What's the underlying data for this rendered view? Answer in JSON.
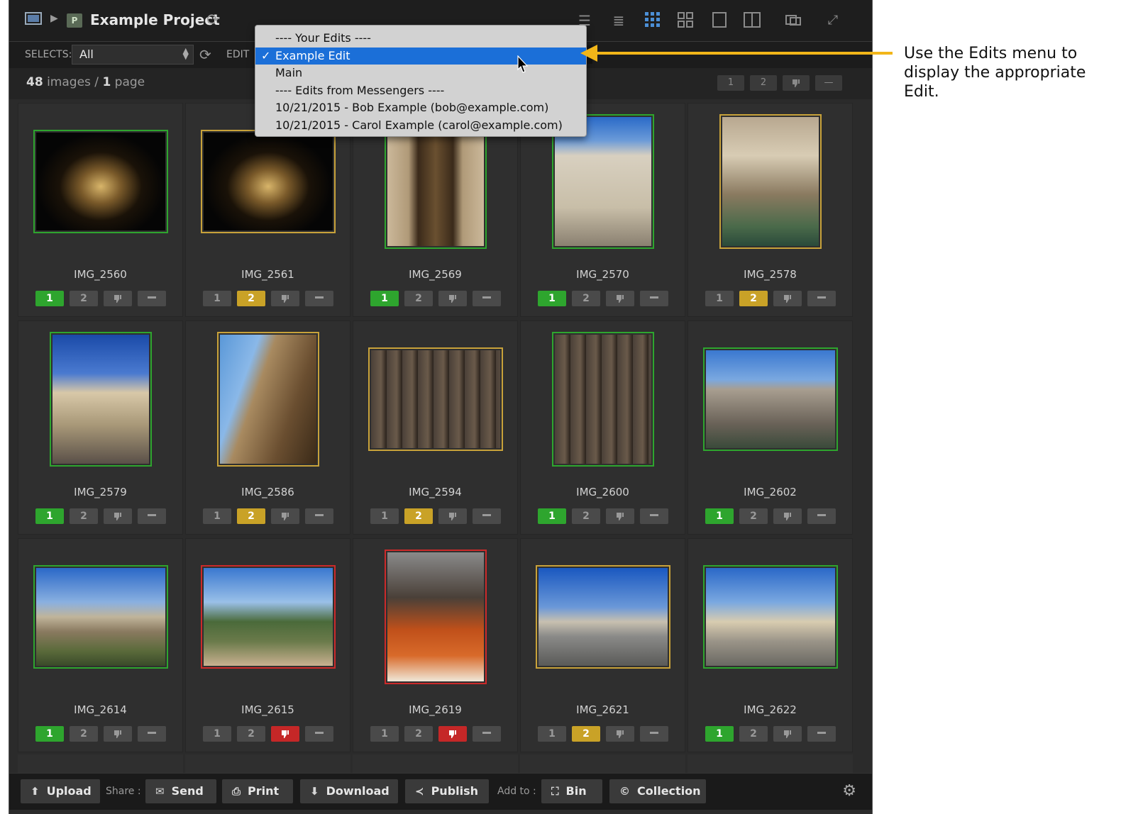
{
  "app": {
    "project_badge": "P",
    "project_title": "Example Project"
  },
  "toolbar": {
    "selects_label": "SELECTS:",
    "selects_value": "All",
    "edits_label": "EDIT"
  },
  "info": {
    "count": "48",
    "count_label": " images",
    "sep": " / ",
    "pages": "1",
    "pages_label": " page"
  },
  "page_buttons": [
    "1",
    "2"
  ],
  "dropdown": {
    "items": [
      {
        "label": "---- Your Edits ----",
        "selected": false
      },
      {
        "label": "Example Edit",
        "selected": true
      },
      {
        "label": "Main",
        "selected": false
      },
      {
        "label": "---- Edits from Messengers ----",
        "selected": false
      },
      {
        "label": "10/21/2015 - Bob Example (bob@example.com)",
        "selected": false
      },
      {
        "label": "10/21/2015 - Carol Example (carol@example.com)",
        "selected": false
      }
    ],
    "check": "✓"
  },
  "rating_labels": {
    "one": "1",
    "two": "2"
  },
  "images": [
    {
      "name": "IMG_2560",
      "rating": "1",
      "border": "green",
      "scene": "night"
    },
    {
      "name": "IMG_2561",
      "rating": "2",
      "border": "yellow",
      "scene": "night"
    },
    {
      "name": "IMG_2569",
      "rating": "1",
      "border": "green",
      "scene": "doorway"
    },
    {
      "name": "IMG_2570",
      "rating": "1",
      "border": "green",
      "scene": "church"
    },
    {
      "name": "IMG_2578",
      "rating": "2",
      "border": "yellow",
      "scene": "fountain"
    },
    {
      "name": "IMG_2579",
      "rating": "1",
      "border": "green",
      "scene": "piazza"
    },
    {
      "name": "IMG_2586",
      "rating": "2",
      "border": "yellow",
      "scene": "ruins"
    },
    {
      "name": "IMG_2594",
      "rating": "2",
      "border": "yellow",
      "scene": "columns"
    },
    {
      "name": "IMG_2600",
      "rating": "1",
      "border": "green",
      "scene": "columns"
    },
    {
      "name": "IMG_2602",
      "rating": "1",
      "border": "green",
      "scene": "pantheon"
    },
    {
      "name": "IMG_2614",
      "rating": "1",
      "border": "green",
      "scene": "castle"
    },
    {
      "name": "IMG_2615",
      "rating": "reject",
      "border": "red",
      "scene": "river"
    },
    {
      "name": "IMG_2619",
      "rating": "reject",
      "border": "red",
      "scene": "cafe"
    },
    {
      "name": "IMG_2621",
      "rating": "2",
      "border": "yellow",
      "scene": "square"
    },
    {
      "name": "IMG_2622",
      "rating": "1",
      "border": "green",
      "scene": "basilica"
    }
  ],
  "bottom": {
    "upload": "Upload",
    "share_label": "Share :",
    "send": "Send",
    "print": "Print",
    "download": "Download",
    "publish": "Publish",
    "add_label": "Add to :",
    "bin": "Bin",
    "collection": "Collection"
  },
  "annotation": {
    "text": "Use the Edits menu to display the appropriate Edit."
  },
  "colors": {
    "accent": "#1b6fd8",
    "green": "#2ea52e",
    "yellow": "#c9a227",
    "red": "#c52727",
    "arrow": "#f2b619"
  },
  "icons": [
    "photo-icon",
    "chevron-right-icon",
    "refresh-icon",
    "list-view-icon",
    "grid-view-icon",
    "single-view-icon",
    "compare-icon",
    "fullscreen-icon",
    "upload-icon",
    "envelope-icon",
    "printer-icon",
    "download-icon",
    "share-icon",
    "bin-icon",
    "collection-icon",
    "gear-icon",
    "thumbs-down-icon",
    "minus-icon",
    "checkmark-icon",
    "cursor-icon"
  ]
}
